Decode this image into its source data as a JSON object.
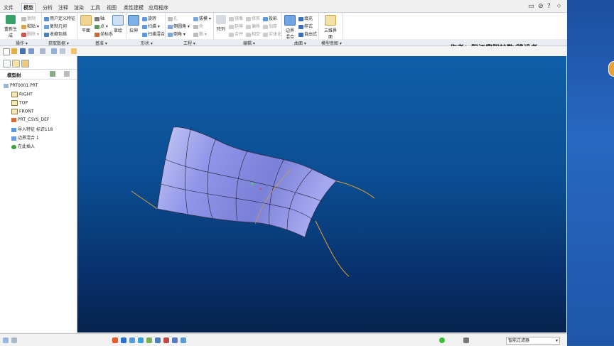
{
  "tabs": {
    "file": "文件",
    "items": [
      "模型",
      "分析",
      "注释",
      "渲染",
      "工具",
      "视图",
      "柔性建模",
      "应用程序"
    ],
    "active": "模型"
  },
  "ribbon": {
    "regenerate": "重新生成",
    "operations": {
      "copy": "复制",
      "paste": "粘贴",
      "delete": "删除"
    },
    "get_data": {
      "udf": "用户定义特征",
      "copy_geom": "复制几何",
      "shrinkwrap": "收缩包络"
    },
    "datum": {
      "plane": "平面",
      "axis": "轴",
      "point": "点",
      "csys": "坐标系",
      "sketch": "草绘"
    },
    "shapes": {
      "extrude": "拉伸",
      "revolve": "旋转",
      "sweep": "扫描",
      "swept_blend": "扫描混合"
    },
    "engineering": {
      "hole": "孔",
      "round": "倒圆角",
      "chamfer": "倒角",
      "draft": "拔模",
      "shell": "壳",
      "rib": "筋"
    },
    "editing": {
      "pattern": "阵列",
      "mirror": "镜像",
      "extend": "延伸",
      "trim": "修剪",
      "merge": "合并",
      "offset": "偏移",
      "intersect": "相交",
      "project": "投影",
      "thicken": "加厚",
      "solidify": "实体化"
    },
    "surfaces": {
      "boundary_blend": "边界混合",
      "fill": "填充",
      "style": "样式",
      "freestyle": "自由式"
    },
    "model_intent": {
      "family_table": "三维界面"
    }
  },
  "groups": [
    "操作",
    "获取数据",
    "基准",
    "形状",
    "工程",
    "编辑",
    "曲面",
    "模型意图"
  ],
  "author_note": "作者：阳江鼎阳抄数/践设者",
  "model_tree": {
    "title": "模型树",
    "items": [
      "PRT0001.PRT",
      "RIGHT",
      "TOP",
      "FRONT",
      "PRT_CSYS_DEF",
      "导入特征 标识118",
      "边界混合 1",
      "在此插入"
    ]
  },
  "status": {
    "filter_label": "智能过滤器"
  },
  "colors": {
    "viewport_top": "#0f5fa8",
    "viewport_bottom": "#06224d",
    "surface": "#8f95e8",
    "accent": "#e0a030"
  }
}
